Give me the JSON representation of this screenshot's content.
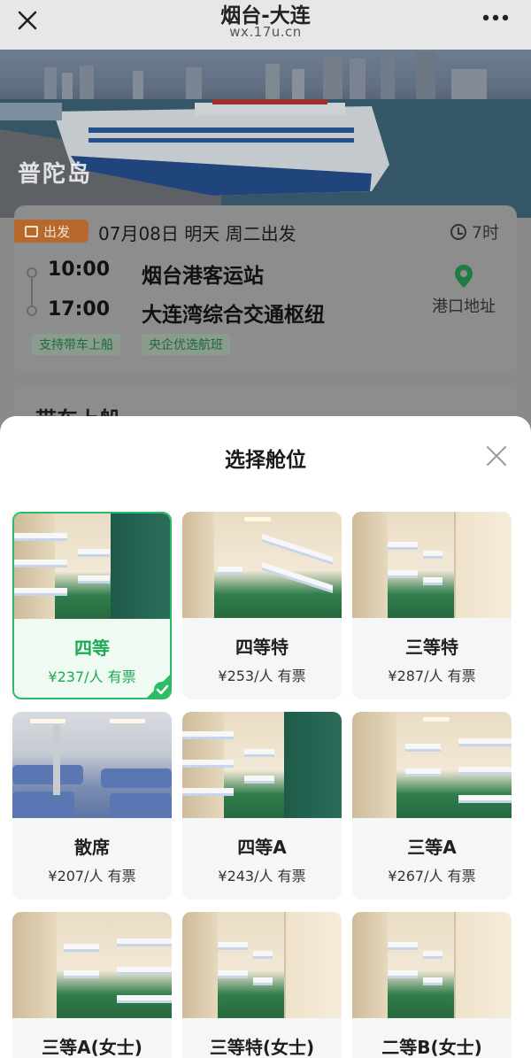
{
  "nav": {
    "title": "烟台-大连",
    "subtitle": "wx.17u.cn",
    "close_icon": "close-icon",
    "more_icon": "more-dots-icon"
  },
  "hero": {
    "ship_name": "普陀岛"
  },
  "trip": {
    "depart_tag": "出发",
    "date_text": "07月08日 明天 周二出发",
    "duration": "7时",
    "depart_time": "10:00",
    "arrive_time": "17:00",
    "depart_port": "烟台港客运站",
    "arrive_port": "大连湾综合交通枢纽",
    "port_address_label": "港口地址",
    "tags": [
      "支持带车上船",
      "央企优选航班"
    ]
  },
  "behind_card": {
    "title": "带车上船"
  },
  "sheet": {
    "title": "选择舱位",
    "cabins": [
      {
        "name": "四等",
        "price": "¥237/人 有票",
        "selected": true
      },
      {
        "name": "四等特",
        "price": "¥253/人 有票",
        "selected": false
      },
      {
        "name": "三等特",
        "price": "¥287/人 有票",
        "selected": false
      },
      {
        "name": "散席",
        "price": "¥207/人 有票",
        "selected": false
      },
      {
        "name": "四等A",
        "price": "¥243/人 有票",
        "selected": false
      },
      {
        "name": "三等A",
        "price": "¥267/人 有票",
        "selected": false
      },
      {
        "name": "三等A(女士)",
        "price": "",
        "selected": false
      },
      {
        "name": "三等特(女士)",
        "price": "",
        "selected": false
      },
      {
        "name": "二等B(女士)",
        "price": "",
        "selected": false
      }
    ]
  },
  "colors": {
    "accent_green": "#2bbd66",
    "tag_orange": "#b8682d"
  }
}
